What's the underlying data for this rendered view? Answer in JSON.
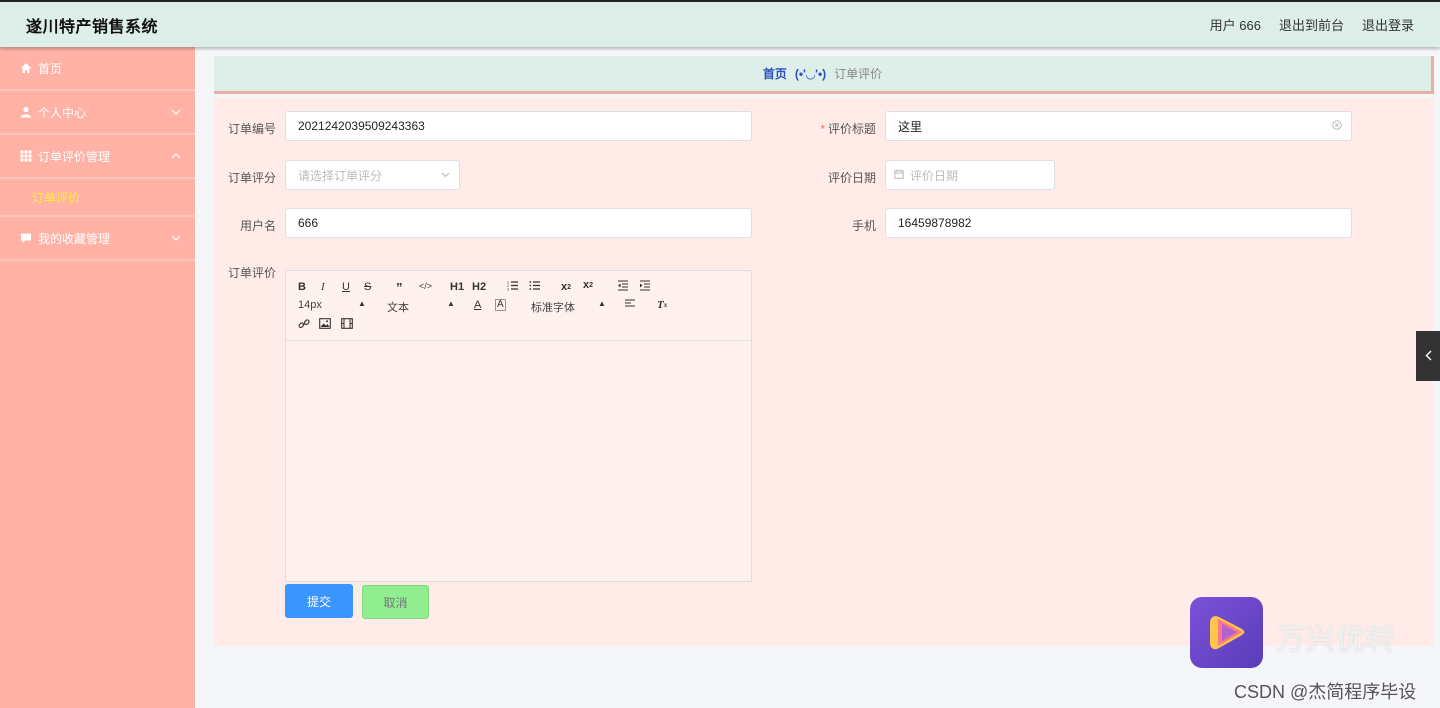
{
  "app": {
    "brand": "遂川特产销售系统",
    "user_label": "用户 666",
    "back_front": "退出到前台",
    "logout": "退出登录"
  },
  "sidebar": {
    "items": [
      {
        "label": "首页",
        "icon": "home-icon"
      },
      {
        "label": "个人中心",
        "icon": "user-icon"
      },
      {
        "label": "订单评价管理",
        "icon": "grid-icon"
      },
      {
        "label": "我的收藏管理",
        "icon": "chat-icon"
      }
    ],
    "sub_item": "订单评价"
  },
  "breadcrumb": {
    "home": "首页",
    "sep": "(•'◡'•)",
    "current": "订单评价"
  },
  "form": {
    "order_no": {
      "label": "订单编号",
      "value": "2021242039509243363"
    },
    "title": {
      "label": "评价标题",
      "required": "*",
      "value": "这里"
    },
    "rating": {
      "label": "订单评分",
      "placeholder": "请选择订单评分"
    },
    "date": {
      "label": "评价日期",
      "placeholder": "评价日期"
    },
    "username": {
      "label": "用户名",
      "value": "666"
    },
    "phone": {
      "label": "手机",
      "value": "16459878982"
    },
    "review": {
      "label": "订单评价"
    }
  },
  "editor": {
    "font_size": "14px",
    "heading": "文本",
    "font_family": "标准字体",
    "h1": "H1",
    "h2": "H2"
  },
  "buttons": {
    "submit": "提交",
    "cancel": "取消"
  },
  "watermark": {
    "brand": "万兴优转",
    "credit": "CSDN @杰简程序毕设"
  }
}
